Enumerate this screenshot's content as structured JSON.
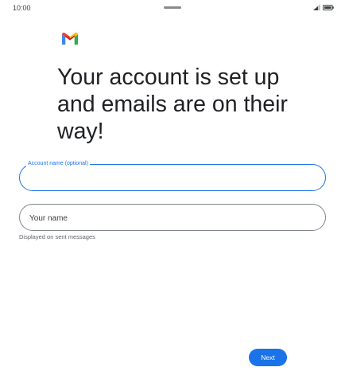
{
  "status_bar": {
    "time": "10:00",
    "signal_icon": "signal-icon",
    "battery_icon": "battery-icon"
  },
  "brand": {
    "logo_icon": "gmail-logo-icon",
    "colors": {
      "blue": "#4285F4",
      "red": "#EA4335",
      "yellow": "#FBBC05",
      "green": "#34A853"
    }
  },
  "headline": "Your account is set up and emails are on their way!",
  "form": {
    "account_name": {
      "label": "Account name (optional)",
      "value": ""
    },
    "your_name": {
      "placeholder": "Your name",
      "value": "",
      "helper": "Displayed on sent messages"
    }
  },
  "actions": {
    "next_label": "Next"
  },
  "colors": {
    "accent": "#1a73e8"
  }
}
